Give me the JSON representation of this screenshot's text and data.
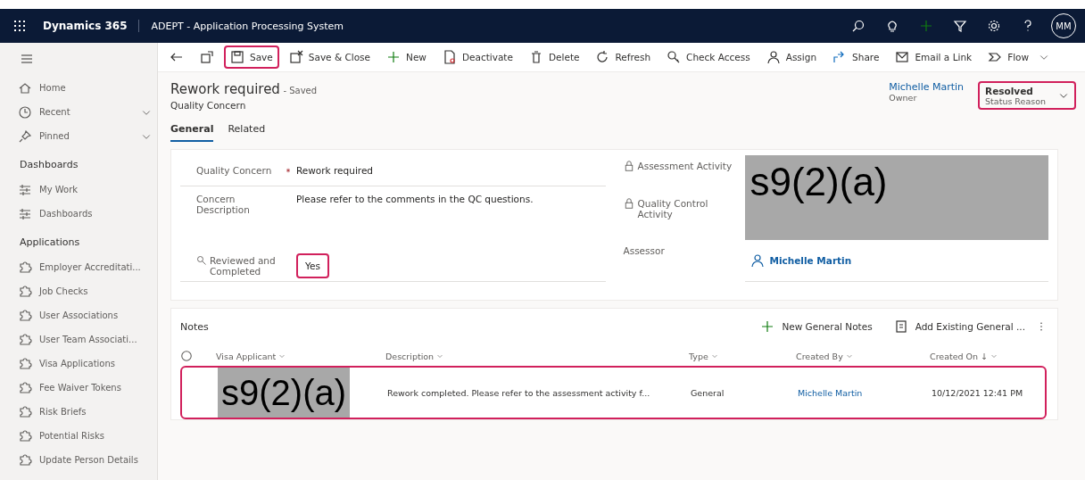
{
  "top_bar": {
    "app_name": "Dynamics 365",
    "title": "ADEPT - Application Processing System",
    "avatar": "MM"
  },
  "sidebar": {
    "sections": [
      {
        "items": [
          {
            "label": "Home",
            "expandable": false
          },
          {
            "label": "Recent",
            "expandable": true
          },
          {
            "label": "Pinned",
            "expandable": true
          }
        ]
      },
      {
        "heading": "Dashboards",
        "items": [
          {
            "label": "My Work",
            "expandable": false
          },
          {
            "label": "Dashboards",
            "expandable": false
          }
        ]
      },
      {
        "heading": "Applications",
        "items": [
          {
            "label": "Employer Accreditati...",
            "expandable": false
          },
          {
            "label": "Job Checks",
            "expandable": false
          },
          {
            "label": "User Associations",
            "expandable": false
          },
          {
            "label": "User Team Associati...",
            "expandable": false
          },
          {
            "label": "Visa Applications",
            "expandable": false
          },
          {
            "label": "Fee Waiver Tokens",
            "expandable": false
          },
          {
            "label": "Risk Briefs",
            "expandable": false
          },
          {
            "label": "Potential Risks",
            "expandable": false
          },
          {
            "label": "Update Person Details",
            "expandable": false
          }
        ]
      }
    ]
  },
  "commands": [
    {
      "label": "Save",
      "highlighted": true
    },
    {
      "label": "Save & Close",
      "highlighted": false
    },
    {
      "label": "New",
      "highlighted": false
    },
    {
      "label": "Deactivate",
      "highlighted": false
    },
    {
      "label": "Delete",
      "highlighted": false
    },
    {
      "label": "Refresh",
      "highlighted": false
    },
    {
      "label": "Check Access",
      "highlighted": false
    },
    {
      "label": "Assign",
      "highlighted": false
    },
    {
      "label": "Share",
      "highlighted": false
    },
    {
      "label": "Email a Link",
      "highlighted": false
    },
    {
      "label": "Flow",
      "highlighted": false
    }
  ],
  "record": {
    "title": "Rework required",
    "save_state": "- Saved",
    "entity": "Quality Concern",
    "owner": {
      "name": "Michelle Martin",
      "label": "Owner"
    },
    "status": {
      "value": "Resolved",
      "label": "Status Reason",
      "highlighted": true
    }
  },
  "tabs": [
    {
      "label": "General",
      "selected": true
    },
    {
      "label": "Related",
      "selected": false
    }
  ],
  "form": {
    "left": [
      {
        "label": "Quality Concern",
        "required": true,
        "value": "Rework required",
        "highlighted": false
      },
      {
        "label": "Concern Description",
        "required": false,
        "value": "Please refer to the comments in the QC questions.",
        "highlighted": false
      },
      {
        "label": "Reviewed and Completed",
        "required": false,
        "value": "Yes",
        "highlighted": true
      }
    ],
    "right": [
      {
        "label": "Assessment Activity",
        "locked": true
      },
      {
        "label": "Quality Control Activity",
        "locked": true
      },
      {
        "label": "Assessor",
        "locked": false
      }
    ],
    "redaction": "s9(2)(a)",
    "assessor": "Michelle Martin"
  },
  "notes": {
    "title": "Notes",
    "actions": [
      "New General Notes",
      "Add Existing General ..."
    ],
    "columns": [
      "Visa Applicant",
      "Description",
      "Type",
      "Created By",
      "Created On ↓"
    ],
    "rows": [
      {
        "visa_applicant": "s9(2)(a)",
        "description": "Rework completed. Please refer to the assessment activity f...",
        "type": "General",
        "created_by": "Michelle Martin",
        "created_on": "10/12/2021 12:41 PM",
        "highlighted": true
      }
    ]
  }
}
